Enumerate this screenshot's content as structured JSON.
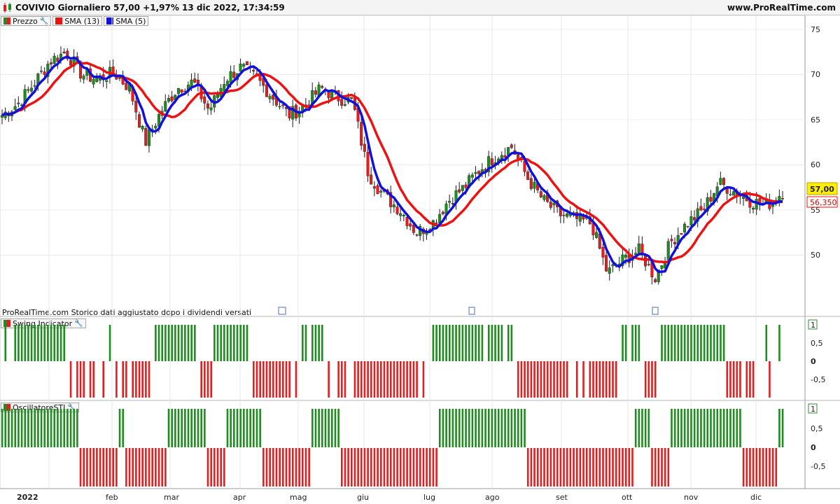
{
  "header": {
    "title": "COVIVIO Giornaliero 57,00 +1,97% 13 dic 2022, 17:34:59",
    "site": "www.ProRealTime.com"
  },
  "price_legend": [
    {
      "label": "Prezzo",
      "kind": "candle"
    },
    {
      "label": "SMA (13)",
      "color": "#ee1111"
    },
    {
      "label": "SMA (5)",
      "color": "#1111dd"
    }
  ],
  "note": "ProRealTime.com Storico dati aggiustato dopo i dividendi versati",
  "price_axis": {
    "ticks": [
      "75",
      "70",
      "65",
      "60",
      "55",
      "50"
    ],
    "current_price": "57,00",
    "sma13_value": "56,350"
  },
  "swing_panel": {
    "title": "Swing Indicator",
    "ticks": [
      "1",
      "0,5",
      "0",
      "-0,5"
    ]
  },
  "oscillator_panel": {
    "title": "OscillatoreSTI",
    "ticks": [
      "1",
      "0,5",
      "0",
      "-0,5"
    ]
  },
  "x_axis": {
    "labels": [
      "2022",
      "feb",
      "mar",
      "apr",
      "mag",
      "giu",
      "lug",
      "ago",
      "set",
      "ott",
      "nov",
      "dic"
    ]
  },
  "colors": {
    "up": "#1e8c1e",
    "down": "#e02020",
    "sma13": "#ee1111",
    "sma5": "#1111dd",
    "price_label_bg": "#ffee00"
  },
  "chart_data": [
    {
      "type": "line",
      "title": "COVIVIO Giornaliero",
      "series": [
        {
          "name": "Prezzo",
          "x": [
            "2022-01-03",
            "2022-01-10",
            "2022-01-17",
            "2022-01-24",
            "2022-01-31",
            "2022-02-07",
            "2022-02-14",
            "2022-02-21",
            "2022-02-28",
            "2022-03-07",
            "2022-03-14",
            "2022-03-21",
            "2022-03-28",
            "2022-04-04",
            "2022-04-11",
            "2022-04-18",
            "2022-04-25",
            "2022-05-02",
            "2022-05-09",
            "2022-05-16",
            "2022-05-23",
            "2022-05-30",
            "2022-06-06",
            "2022-06-13",
            "2022-06-20",
            "2022-06-27",
            "2022-07-04",
            "2022-07-11",
            "2022-07-18",
            "2022-07-25",
            "2022-08-01",
            "2022-08-08",
            "2022-08-15",
            "2022-08-22",
            "2022-08-29",
            "2022-09-05",
            "2022-09-12",
            "2022-09-19",
            "2022-09-26",
            "2022-10-03",
            "2022-10-10",
            "2022-10-17",
            "2022-10-24",
            "2022-10-31",
            "2022-11-07",
            "2022-11-14",
            "2022-11-21",
            "2022-11-28",
            "2022-12-05",
            "2022-12-13"
          ],
          "values": [
            65.5,
            66.8,
            69.0,
            71.5,
            72.5,
            70.0,
            69.5,
            70.2,
            68.5,
            62.5,
            66.0,
            68.5,
            69.2,
            66.0,
            69.5,
            70.8,
            69.5,
            67.5,
            65.5,
            66.5,
            68.5,
            67.5,
            67.0,
            59.0,
            56.5,
            55.0,
            52.5,
            53.5,
            56.0,
            57.5,
            59.5,
            61.0,
            62.0,
            58.5,
            56.0,
            54.5,
            54.0,
            53.5,
            48.0,
            49.5,
            50.5,
            47.5,
            51.5,
            53.5,
            55.0,
            58.0,
            57.0,
            56.0,
            55.5,
            57.0
          ]
        },
        {
          "name": "SMA (13)",
          "x": [
            "2022-01-03",
            "2022-01-31",
            "2022-02-28",
            "2022-03-28",
            "2022-04-25",
            "2022-05-23",
            "2022-06-20",
            "2022-07-18",
            "2022-08-15",
            "2022-09-12",
            "2022-10-10",
            "2022-11-07",
            "2022-12-13"
          ],
          "values": [
            68.5,
            70.0,
            70.5,
            66.0,
            69.5,
            68.0,
            59.0,
            55.5,
            60.0,
            55.5,
            49.0,
            56.0,
            56.35
          ]
        },
        {
          "name": "SMA (5)",
          "x": [
            "2022-01-03",
            "2022-01-31",
            "2022-02-28",
            "2022-03-28",
            "2022-04-25",
            "2022-05-23",
            "2022-06-20",
            "2022-07-18",
            "2022-08-15",
            "2022-09-12",
            "2022-10-10",
            "2022-11-07",
            "2022-12-13"
          ],
          "values": [
            66.5,
            72.0,
            70.0,
            68.0,
            69.0,
            67.5,
            56.5,
            55.5,
            61.0,
            54.5,
            48.5,
            57.5,
            56.8
          ]
        }
      ],
      "ylim": [
        45,
        76
      ]
    },
    {
      "type": "bar",
      "title": "Swing Indicator",
      "values_pattern": "alternating runs of +1 (green) and -1 (red)",
      "ylim": [
        -1,
        1
      ]
    },
    {
      "type": "bar",
      "title": "OscillatoreSTI",
      "values_pattern": "alternating runs of +1 (green) and -1 (red)",
      "ylim": [
        -1,
        1
      ]
    }
  ]
}
